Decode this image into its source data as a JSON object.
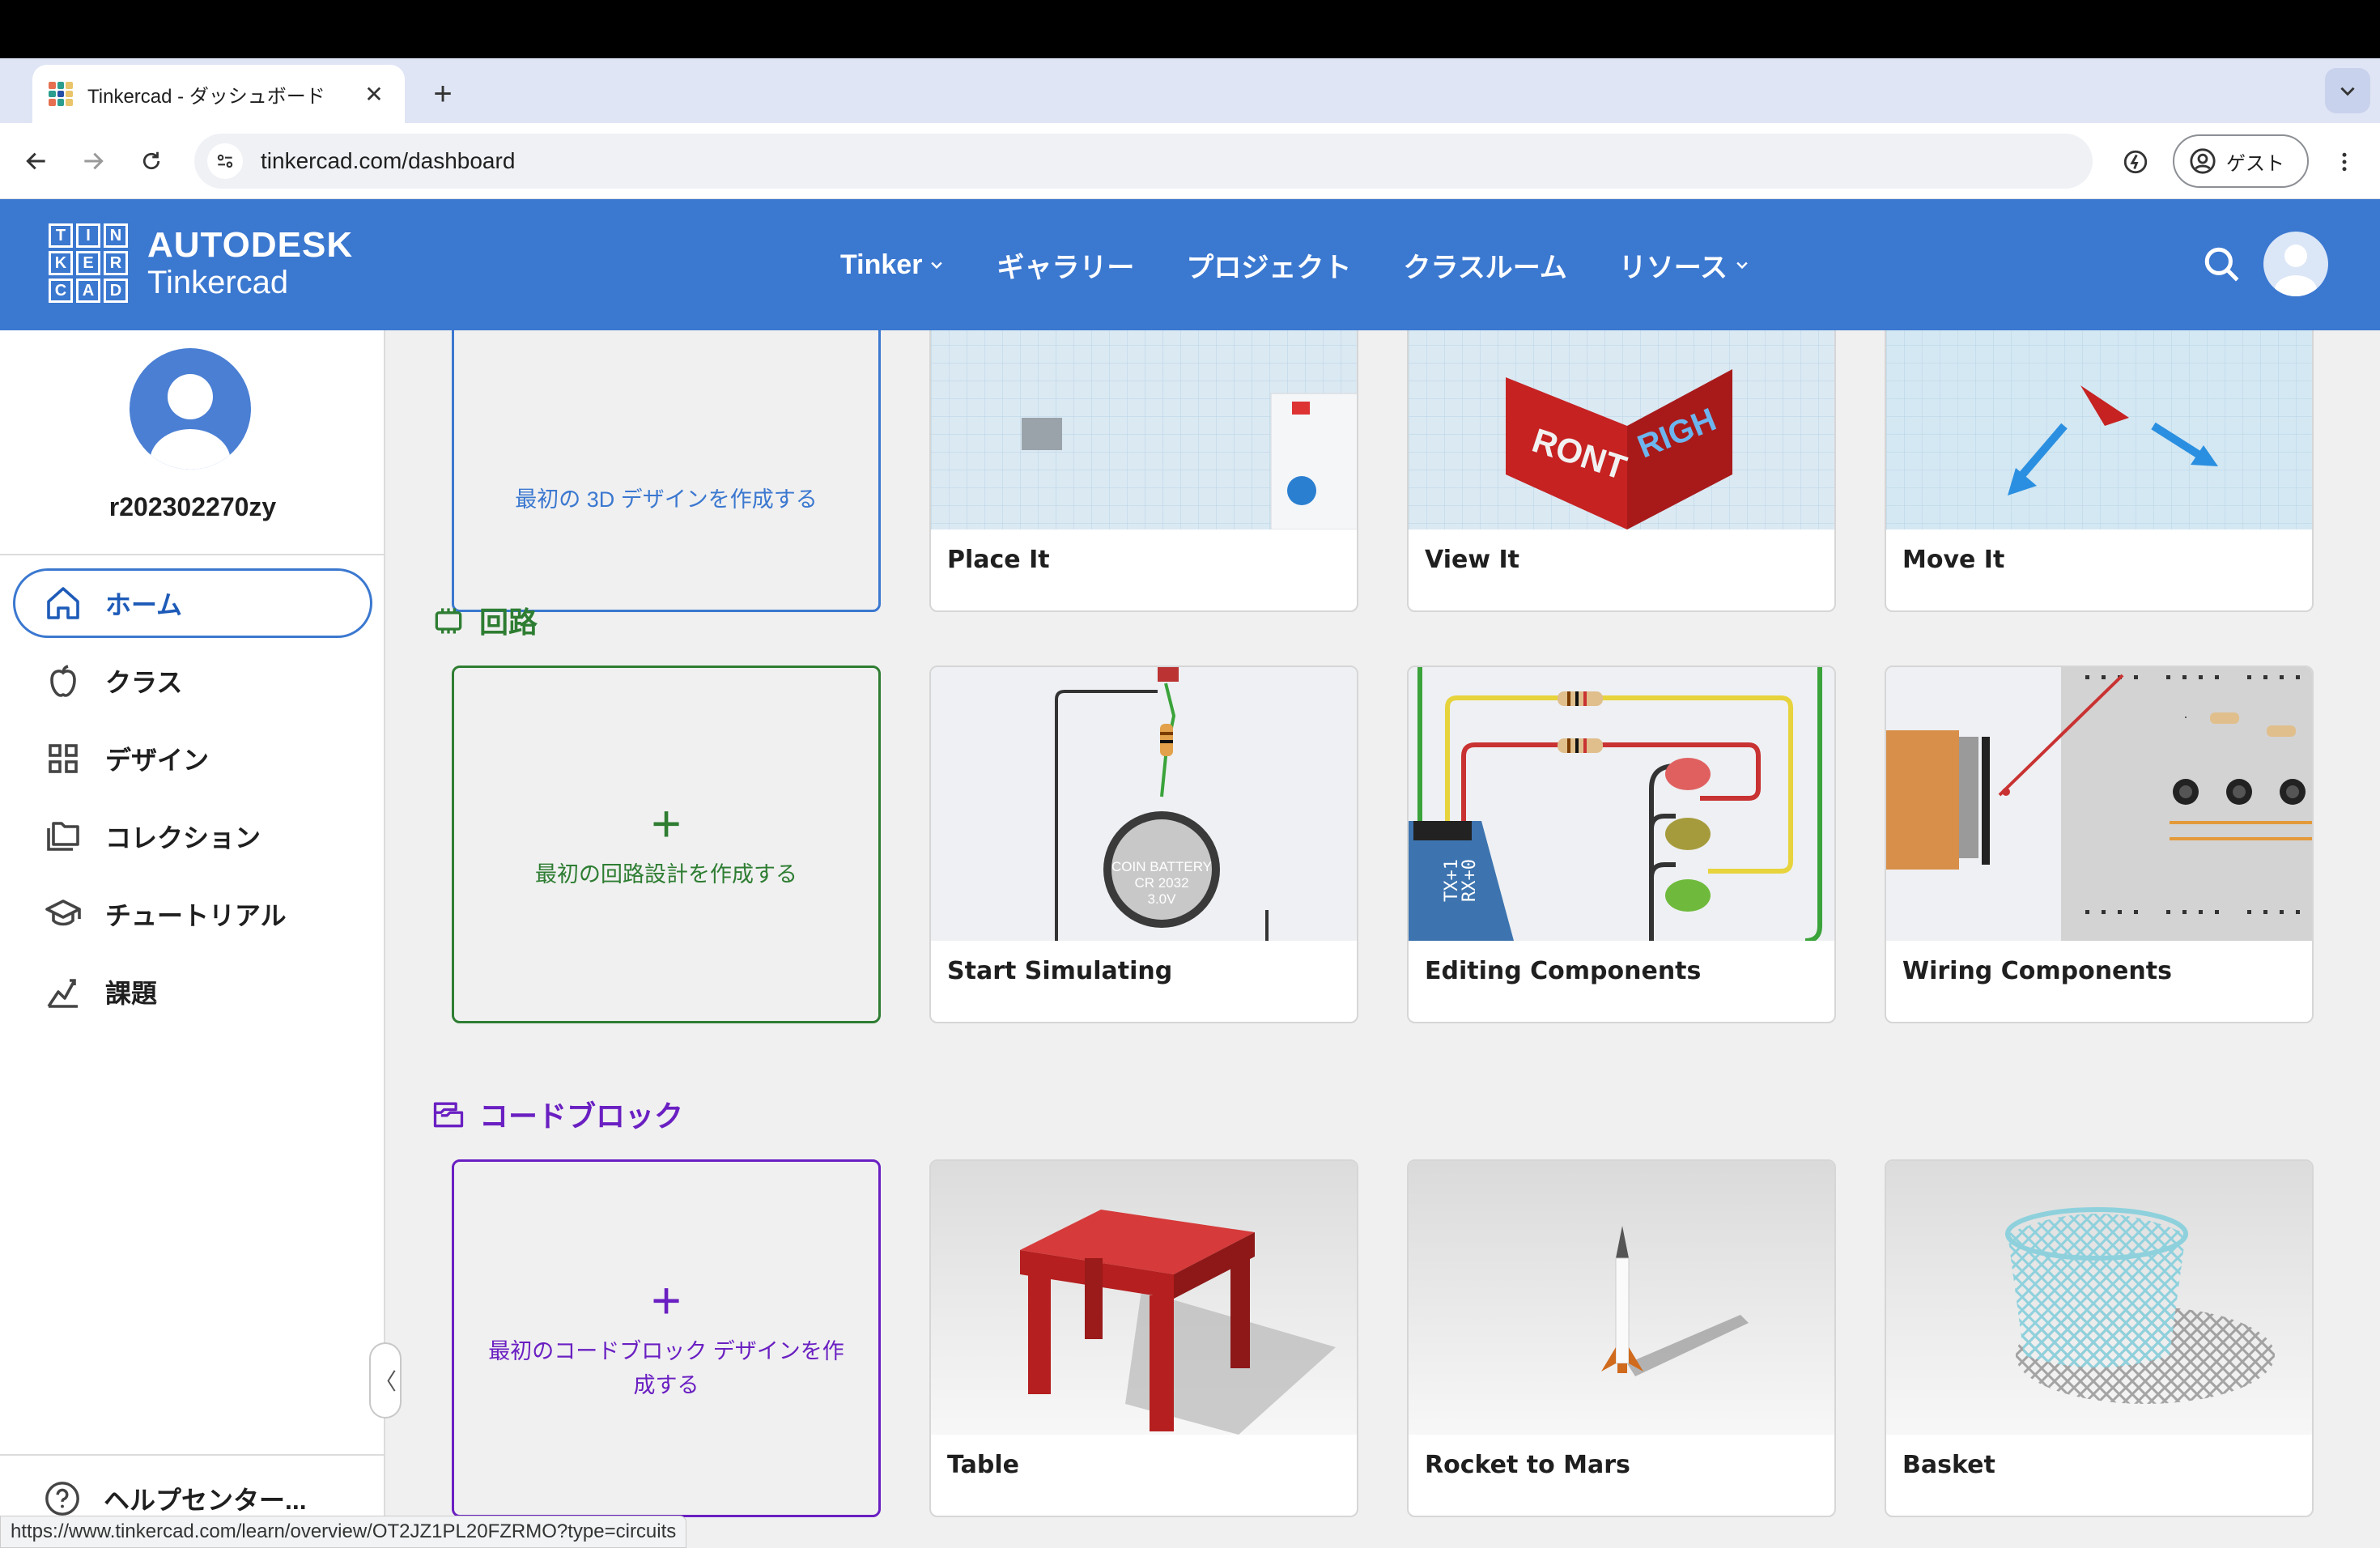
{
  "browser": {
    "tab_title": "Tinkercad - ダッシュボード",
    "tab_close": "✕",
    "new_tab": "+",
    "url": "tinkercad.com/dashboard",
    "guest_label": "ゲスト",
    "status_url": "https://www.tinkercad.com/learn/overview/OT2JZ1PL20FZRMO?type=circuits"
  },
  "header": {
    "logo_letters": [
      "T",
      "I",
      "N",
      "K",
      "E",
      "R",
      "C",
      "A",
      "D"
    ],
    "brand_top": "AUTODESK",
    "brand_bottom": "Tinkercad",
    "nav": [
      {
        "label": "Tinker",
        "dropdown": true
      },
      {
        "label": "ギャラリー",
        "dropdown": false
      },
      {
        "label": "プロジェクト",
        "dropdown": false
      },
      {
        "label": "クラスルーム",
        "dropdown": false
      },
      {
        "label": "リソース",
        "dropdown": true
      }
    ]
  },
  "sidebar": {
    "username": "r202302270zy",
    "items": [
      {
        "label": "ホーム",
        "icon": "home-icon",
        "active": true
      },
      {
        "label": "クラス",
        "icon": "apple-icon",
        "active": false
      },
      {
        "label": "デザイン",
        "icon": "grid-icon",
        "active": false
      },
      {
        "label": "コレクション",
        "icon": "collection-icon",
        "active": false
      },
      {
        "label": "チュートリアル",
        "icon": "graduation-cap-icon",
        "active": false
      },
      {
        "label": "課題",
        "icon": "chart-icon",
        "active": false
      }
    ],
    "collapse": "〈",
    "help": "ヘルプセンター..."
  },
  "sections": {
    "design3d": {
      "create_label": "最初の 3D デザインを作成する",
      "cards": [
        "Place It",
        "View It",
        "Move It"
      ]
    },
    "circuits": {
      "title": "回路",
      "create_label": "最初の回路設計を作成する",
      "cards": [
        "Start Simulating",
        "Editing Components",
        "Wiring Components"
      ]
    },
    "codeblocks": {
      "title": "コードブロック",
      "create_label": "最初のコードブロック デザインを作成する",
      "cards": [
        "Table",
        "Rocket to Mars",
        "Basket"
      ]
    }
  },
  "plus": "+",
  "battery_text": [
    "COIN BATTERY",
    "CR 2032",
    "3.0V"
  ],
  "arduino_pins": [
    "TX+1",
    "RX+0"
  ],
  "colors": {
    "brand_blue": "#3b78d0",
    "circuits_green": "#2e7d32",
    "codeblocks_purple": "#6a1fc2"
  }
}
